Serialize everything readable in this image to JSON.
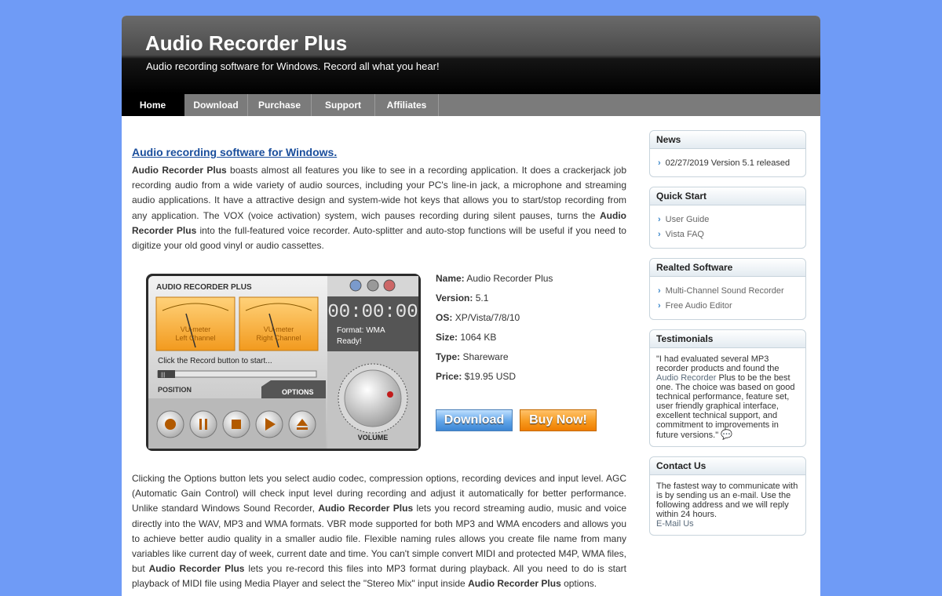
{
  "site": {
    "title": "Audio Recorder Plus",
    "subtitle": "Audio recording software for Windows. Record all what you hear!"
  },
  "nav": {
    "tabs": [
      "Home",
      "Download",
      "Purchase",
      "Support",
      "Affiliates"
    ],
    "active": "Home"
  },
  "main": {
    "heading": "Audio recording software for Windows.",
    "para1": {
      "lead": "Audio Recorder Plus",
      "t1": " boasts almost all features you like to see in a recording application. It does a crackerjack job recording audio from a wide variety of audio sources, including your PC's line-in jack, a microphone and streaming audio applications. It have a attractive design and system-wide hot keys that allows you to start/stop recording from any application. The VOX (voice activation) system, wich pauses recording during silent pauses, turns the ",
      "b2": "Audio Recorder Plus",
      "t2": " into the full-featured voice recorder. Auto-splitter and auto-stop functions will be useful if you need to digitize your old good vinyl or audio cassettes."
    },
    "para2": {
      "t1": "Clicking the Options button lets you select audio codec, compression options, recording devices and input level. AGC (Automatic Gain Control) will check input level during recording and adjust it automatically for better performance. Unlike standard Windows Sound Recorder, ",
      "b1": "Audio Recorder Plus",
      "t2": " lets you record streaming audio, music and voice directly into the WAV, MP3 and WMA formats. VBR mode supported for both MP3 and WMA encoders and allows you to achieve better audio quality in a smaller audio file. Flexible naming rules allows you create file name from many variables like current day of week, current date and time. You can't simple convert MIDI and protected M4P, WMA files, but ",
      "b2": "Audio Recorder Plus",
      "t3": " lets you re-record this files into MP3 format during playback. All you need to do is start playback of MIDI file using Media Player and select the \"Stereo Mix\" input inside ",
      "b3": "Audio Recorder Plus",
      "t4": " options."
    }
  },
  "screenshot": {
    "app_title": "AUDIO RECORDER PLUS",
    "vu_left": "VU-meter\nLeft Channel",
    "vu_right": "VU-meter\nRight Channel",
    "status": "Click the Record button to start...",
    "time": "00:00:00",
    "format": "Format: WMA",
    "ready": "Ready!",
    "position_label": "POSITION",
    "options_label": "OPTIONS",
    "volume_label": "VOLUME",
    "slider_thumb": "|||"
  },
  "info": {
    "rows": [
      {
        "label": "Name:",
        "value": "Audio Recorder Plus"
      },
      {
        "label": "Version:",
        "value": "5.1"
      },
      {
        "label": "OS:",
        "value": "XP/Vista/7/8/10"
      },
      {
        "label": "Size:",
        "value": "1064 KB"
      },
      {
        "label": "Type:",
        "value": "Shareware"
      },
      {
        "label": "Price:",
        "value": "$19.95 USD"
      }
    ],
    "download_label": "Download",
    "buy_label": "Buy Now!"
  },
  "sidebar": {
    "news": {
      "title": "News",
      "items": [
        "02/27/2019 Version 5.1 released"
      ]
    },
    "quickstart": {
      "title": "Quick Start",
      "items": [
        "User Guide",
        "Vista FAQ"
      ]
    },
    "related": {
      "title": "Realted Software",
      "items": [
        "Multi-Channel Sound Recorder",
        "Free Audio Editor"
      ]
    },
    "testimonials": {
      "title": "Testimonials",
      "t1": "\"I had evaluated several MP3 recorder products and found the ",
      "link": "Audio Recorder",
      "t2": " Plus to be the best one. The choice was based on good technical performance, feature set, user friendly graphical interface, excellent technical support, and commitment to improvements in future versions.\""
    },
    "contact": {
      "title": "Contact Us",
      "text": "The fastest way to communicate with is by sending us an e-mail. Use the following address and we will reply within 24 hours.",
      "link": "E-Mail Us"
    }
  }
}
